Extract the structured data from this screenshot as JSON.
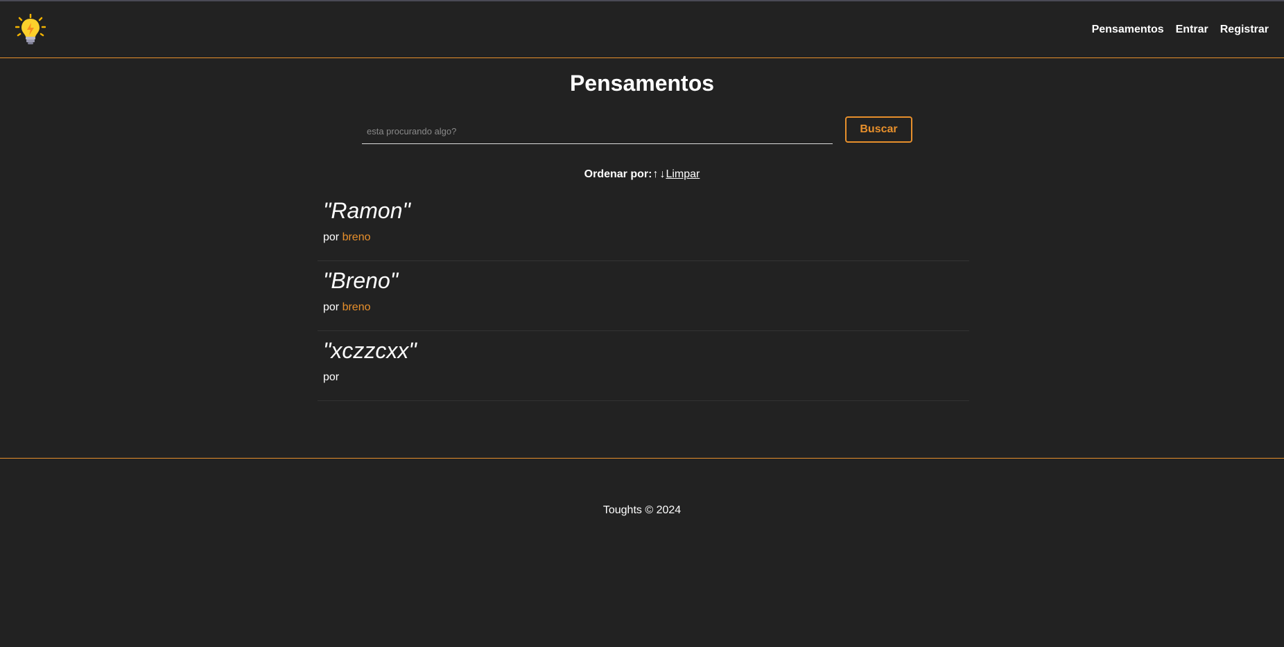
{
  "header": {
    "logo_icon": "lightbulb-icon",
    "nav": [
      {
        "label": "Pensamentos"
      },
      {
        "label": "Entrar"
      },
      {
        "label": "Registrar"
      }
    ]
  },
  "main": {
    "title": "Pensamentos",
    "search": {
      "placeholder": "esta procurando algo?",
      "value": "",
      "button_label": "Buscar"
    },
    "order": {
      "label": "Ordenar por:",
      "asc_icon": "↑",
      "desc_icon": "↓",
      "clear_label": "Limpar"
    },
    "thoughts": [
      {
        "title": "\"Ramon\"",
        "by_label": "por",
        "author": "breno"
      },
      {
        "title": "\"Breno\"",
        "by_label": "por",
        "author": "breno"
      },
      {
        "title": "\"xczzcxx\"",
        "by_label": "por",
        "author": ""
      }
    ]
  },
  "footer": {
    "text": "Toughts © 2024"
  },
  "colors": {
    "background": "#222222",
    "accent": "#e8902c",
    "text": "#ffffff"
  }
}
